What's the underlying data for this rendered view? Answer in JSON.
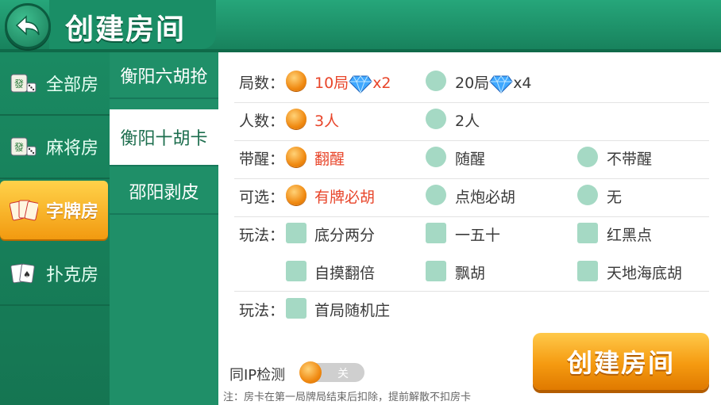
{
  "header": {
    "title": "创建房间"
  },
  "left_nav": [
    {
      "label": "全部房",
      "icon": "mahjong-tile-icon"
    },
    {
      "label": "麻将房",
      "icon": "mahjong-tile-icon"
    },
    {
      "label": "字牌房",
      "icon": "zipai-cards-icon",
      "active": true
    },
    {
      "label": "扑克房",
      "icon": "poker-cards-icon"
    }
  ],
  "sub_nav": [
    {
      "label": "衡阳六胡抢"
    },
    {
      "label": "衡阳十胡卡",
      "active": true
    },
    {
      "label": "邵阳剥皮"
    }
  ],
  "rules": {
    "rounds": {
      "label": "局数：",
      "options": [
        {
          "text": "10局",
          "suffix": "x2",
          "selected": true
        },
        {
          "text": "20局",
          "suffix": "x4",
          "selected": false
        }
      ]
    },
    "players": {
      "label": "人数：",
      "options": [
        {
          "text": "3人",
          "selected": true
        },
        {
          "text": "2人",
          "selected": false
        }
      ]
    },
    "xing": {
      "label": "带醒：",
      "options": [
        {
          "text": "翻醒",
          "selected": true
        },
        {
          "text": "随醒",
          "selected": false
        },
        {
          "text": "不带醒",
          "selected": false
        }
      ]
    },
    "optional": {
      "label": "可选：",
      "options": [
        {
          "text": "有牌必胡",
          "selected": true
        },
        {
          "text": "点炮必胡",
          "selected": false
        },
        {
          "text": "无",
          "selected": false
        }
      ]
    },
    "play1": {
      "label": "玩法：",
      "options": [
        "底分两分",
        "一五十",
        "红黑点",
        "自摸翻倍",
        "飘胡",
        "天地海底胡"
      ]
    },
    "play2": {
      "label": "玩法：",
      "options": [
        "首局随机庄"
      ]
    }
  },
  "ip_check": {
    "label": "同IP检测",
    "state": "关"
  },
  "note": "注：房卡在第一局牌局结束后扣除，提前解散不扣房卡",
  "create_button": "创建房间",
  "colors": {
    "accent": "#f08a12",
    "selected_text": "#e8452a",
    "green": "#1f8a63"
  }
}
